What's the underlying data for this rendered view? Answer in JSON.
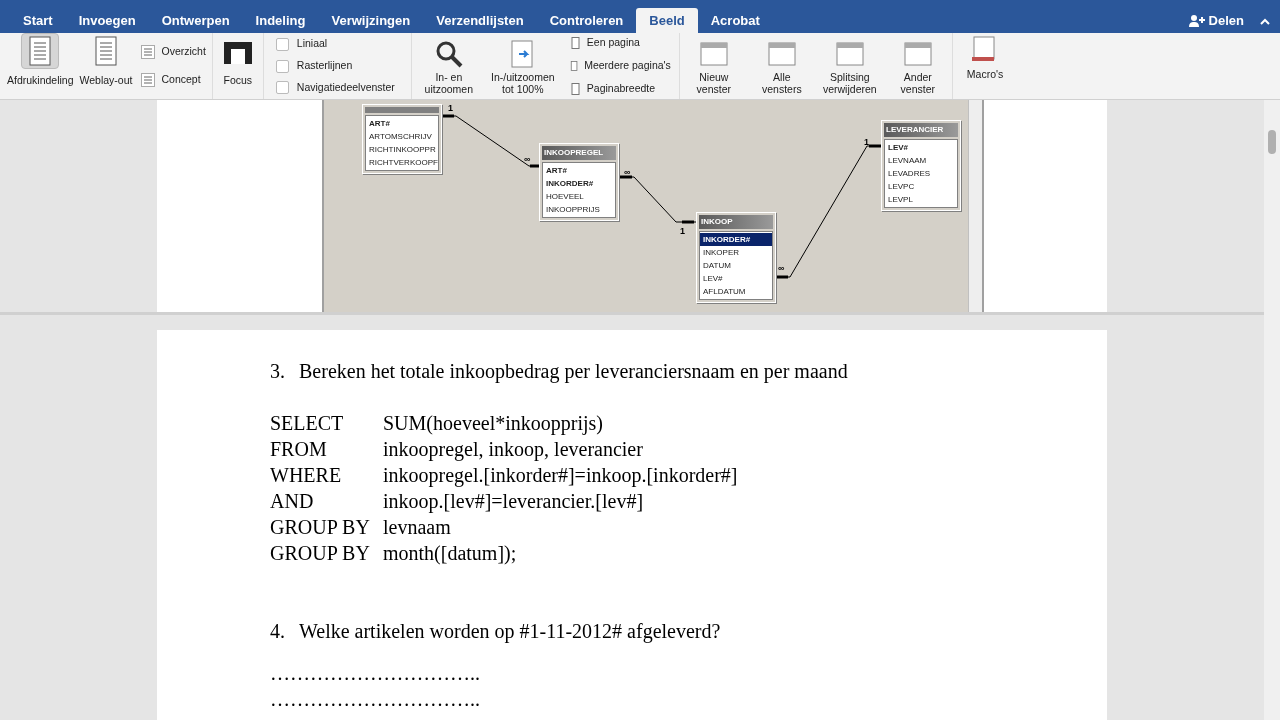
{
  "tabs": [
    {
      "label": "Start",
      "selected": false
    },
    {
      "label": "Invoegen",
      "selected": false
    },
    {
      "label": "Ontwerpen",
      "selected": false
    },
    {
      "label": "Indeling",
      "selected": false
    },
    {
      "label": "Verwijzingen",
      "selected": false
    },
    {
      "label": "Verzendlijsten",
      "selected": false
    },
    {
      "label": "Controleren",
      "selected": false
    },
    {
      "label": "Beeld",
      "selected": true
    },
    {
      "label": "Acrobat",
      "selected": false
    }
  ],
  "share": "Delen",
  "ribbon": {
    "views": [
      {
        "label": "Afdrukindeling",
        "selected": true
      },
      {
        "label": "Weblay-out",
        "selected": false
      }
    ],
    "small_views": [
      "Overzicht",
      "Concept"
    ],
    "focus": "Focus",
    "checks": [
      {
        "label": "Liniaal",
        "checked": false
      },
      {
        "label": "Rasterlijnen",
        "checked": false
      },
      {
        "label": "Navigatiedeelvenster",
        "checked": false
      }
    ],
    "zoom": [
      "In- en uitzoomen",
      "In-/uitzoomen tot 100%"
    ],
    "page_views": [
      "Een pagina",
      "Meerdere pagina's",
      "Paginabreedte"
    ],
    "window": [
      "Nieuw venster",
      "Alle vensters",
      "Splitsing verwijderen",
      "Ander venster"
    ],
    "macros": "Macro's"
  },
  "diagram": {
    "tables": [
      {
        "fields": [
          {
            "name": "ART#",
            "key": true,
            "selected": false
          },
          {
            "name": "ARTOMSCHRIJV",
            "key": false,
            "selected": false
          },
          {
            "name": "RICHTINKOOPPR",
            "key": false,
            "selected": false
          },
          {
            "name": "RICHTVERKOOPF",
            "key": false,
            "selected": false
          }
        ]
      },
      {
        "title": "INKOOPREGEL",
        "fields": [
          {
            "name": "ART#",
            "key": true,
            "selected": false
          },
          {
            "name": "INKORDER#",
            "key": true,
            "selected": false
          },
          {
            "name": "HOEVEEL",
            "key": false,
            "selected": false
          },
          {
            "name": "INKOOPPRIJS",
            "key": false,
            "selected": false
          }
        ]
      },
      {
        "title": "INKOOP",
        "fields": [
          {
            "name": "INKORDER#",
            "key": true,
            "selected": true
          },
          {
            "name": "INKOPER",
            "key": false,
            "selected": false
          },
          {
            "name": "DATUM",
            "key": false,
            "selected": false
          },
          {
            "name": "LEV#",
            "key": false,
            "selected": false
          },
          {
            "name": "AFLDATUM",
            "key": false,
            "selected": false
          }
        ]
      },
      {
        "title": "LEVERANCIER",
        "fields": [
          {
            "name": "LEV#",
            "key": true,
            "selected": false
          },
          {
            "name": "LEVNAAM",
            "key": false,
            "selected": false
          },
          {
            "name": "LEVADRES",
            "key": false,
            "selected": false
          },
          {
            "name": "LEVPC",
            "key": false,
            "selected": false
          },
          {
            "name": "LEVPL",
            "key": false,
            "selected": false
          }
        ]
      }
    ],
    "labels": [
      "1",
      "∞",
      "∞",
      "1",
      "∞",
      "1"
    ]
  },
  "question3": {
    "number": "3.",
    "text": "Bereken het totale inkoopbedrag per leveranciersnaam en per maand"
  },
  "sql": [
    {
      "keyword": "SELECT",
      "clause": "SUM(hoeveel*inkoopprijs)"
    },
    {
      "keyword": "FROM",
      "clause": "inkoopregel, inkoop, leverancier"
    },
    {
      "keyword": "WHERE",
      "clause": "inkoopregel.[inkorder#]=inkoop.[inkorder#]"
    },
    {
      "keyword": "AND",
      "clause": "inkoop.[lev#]=leverancier.[lev#]"
    },
    {
      "keyword": "GROUP BY",
      "clause": "levnaam"
    },
    {
      "keyword": "GROUP BY",
      "clause": "month([datum]);"
    }
  ],
  "question4": {
    "number": "4.",
    "text": "Welke artikelen worden op #1-11-2012# afgeleverd?"
  },
  "answer_lines": [
    "…………………………..",
    "………………………….."
  ]
}
